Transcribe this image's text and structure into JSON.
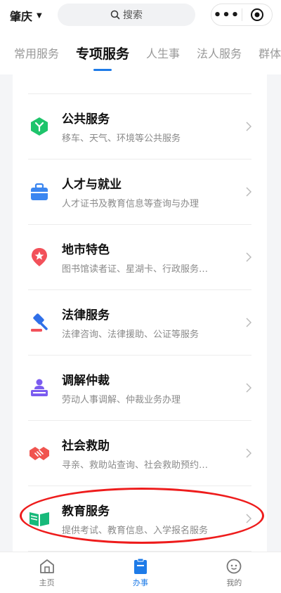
{
  "header": {
    "city": "肇庆",
    "search_label": "搜索"
  },
  "tabs": [
    {
      "label": "常用服务",
      "active": false
    },
    {
      "label": "专项服务",
      "active": true
    },
    {
      "label": "人生事",
      "active": false
    },
    {
      "label": "法人服务",
      "active": false
    },
    {
      "label": "群体",
      "active": false
    }
  ],
  "services": [
    {
      "title": "公共服务",
      "desc": "移车、天气、环境等公共服务",
      "icon": "public-service-icon",
      "color": "#1ec46b"
    },
    {
      "title": "人才与就业",
      "desc": "人才证书及教育信息等查询与办理",
      "icon": "briefcase-icon",
      "color": "#3b86f0"
    },
    {
      "title": "地市特色",
      "desc": "图书馆读者证、星湖卡、行政服务…",
      "icon": "location-star-icon",
      "color": "#f2515a"
    },
    {
      "title": "法律服务",
      "desc": "法律咨询、法律援助、公证等服务",
      "icon": "gavel-icon",
      "color": "#2f6fe8"
    },
    {
      "title": "调解仲裁",
      "desc": "劳动人事调解、仲裁业务办理",
      "icon": "mediator-icon",
      "color": "#7b5cf0"
    },
    {
      "title": "社会救助",
      "desc": "寻亲、救助站查询、社会救助预约…",
      "icon": "handshake-icon",
      "color": "#f0544f"
    },
    {
      "title": "教育服务",
      "desc": "提供考试、教育信息、入学报名服务",
      "icon": "open-book-icon",
      "color": "#17b97a"
    }
  ],
  "bottom_nav": [
    {
      "label": "主页",
      "icon": "home-icon",
      "active": false
    },
    {
      "label": "办事",
      "icon": "clipboard-icon",
      "active": true
    },
    {
      "label": "我的",
      "icon": "profile-face-icon",
      "active": false
    }
  ],
  "colors": {
    "accent": "#1e7be8",
    "highlight_ring": "#ee1c1c"
  }
}
